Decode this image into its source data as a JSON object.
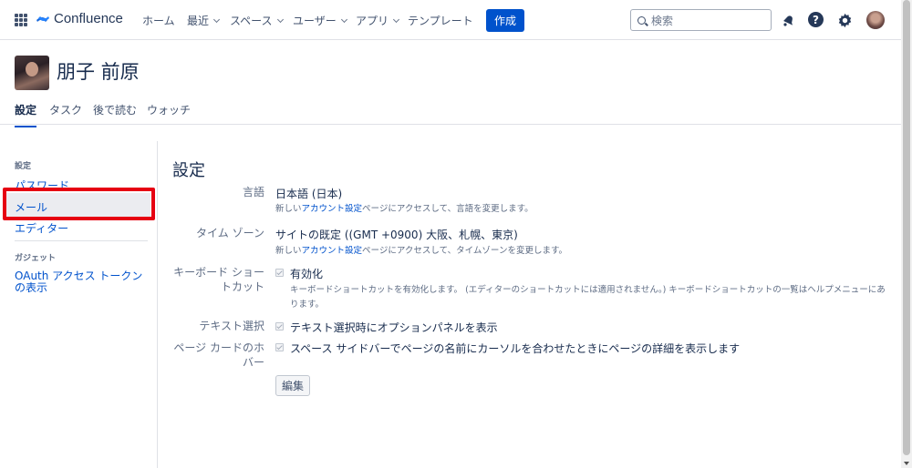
{
  "header": {
    "logo_text": "Confluence",
    "nav": [
      "ホーム",
      "最近",
      "スペース",
      "ユーザー",
      "アプリ",
      "テンプレート"
    ],
    "create_label": "作成",
    "search_placeholder": "検索"
  },
  "profile": {
    "name": "朋子 前原",
    "tabs": [
      "設定",
      "タスク",
      "後で読む",
      "ウォッチ"
    ]
  },
  "sidebar": {
    "settings_heading": "設定",
    "settings_items": [
      "パスワード",
      "メール",
      "エディター"
    ],
    "gadget_heading": "ガジェット",
    "gadget_items": [
      "OAuth アクセス トークンの表示"
    ]
  },
  "main": {
    "title": "設定",
    "language": {
      "label": "言語",
      "value": "日本語 (日本)",
      "desc_prefix": "新しい",
      "desc_link": "アカウント設定",
      "desc_suffix": "ページにアクセスして、言語を変更します。"
    },
    "timezone": {
      "label": "タイム ゾーン",
      "value": "サイトの既定 ((GMT +0900) 大阪、札幌、東京)",
      "desc_prefix": "新しい",
      "desc_link": "アカウント設定",
      "desc_suffix": "ページにアクセスして、タイムゾーンを変更します。"
    },
    "shortcuts": {
      "label": "キーボード ショートカット",
      "checkbox_label": "有効化",
      "desc": "キーボードショートカットを有効化します。 (エディターのショートカットには適用されません。) キーボードショートカットの一覧はヘルプメニューにあります。",
      "checked": true
    },
    "text_selection": {
      "label": "テキスト選択",
      "checkbox_label": "テキスト選択時にオプションパネルを表示",
      "checked": true
    },
    "page_card_hover": {
      "label": "ページ カードのホバー",
      "checkbox_label": "スペース サイドバーでページの名前にカーソルを合わせたときにページの詳細を表示します",
      "checked": true
    },
    "edit_label": "編集"
  },
  "colors": {
    "link": "#0052cc",
    "primary_button": "#0052cc",
    "highlight_box": "#e60012"
  }
}
